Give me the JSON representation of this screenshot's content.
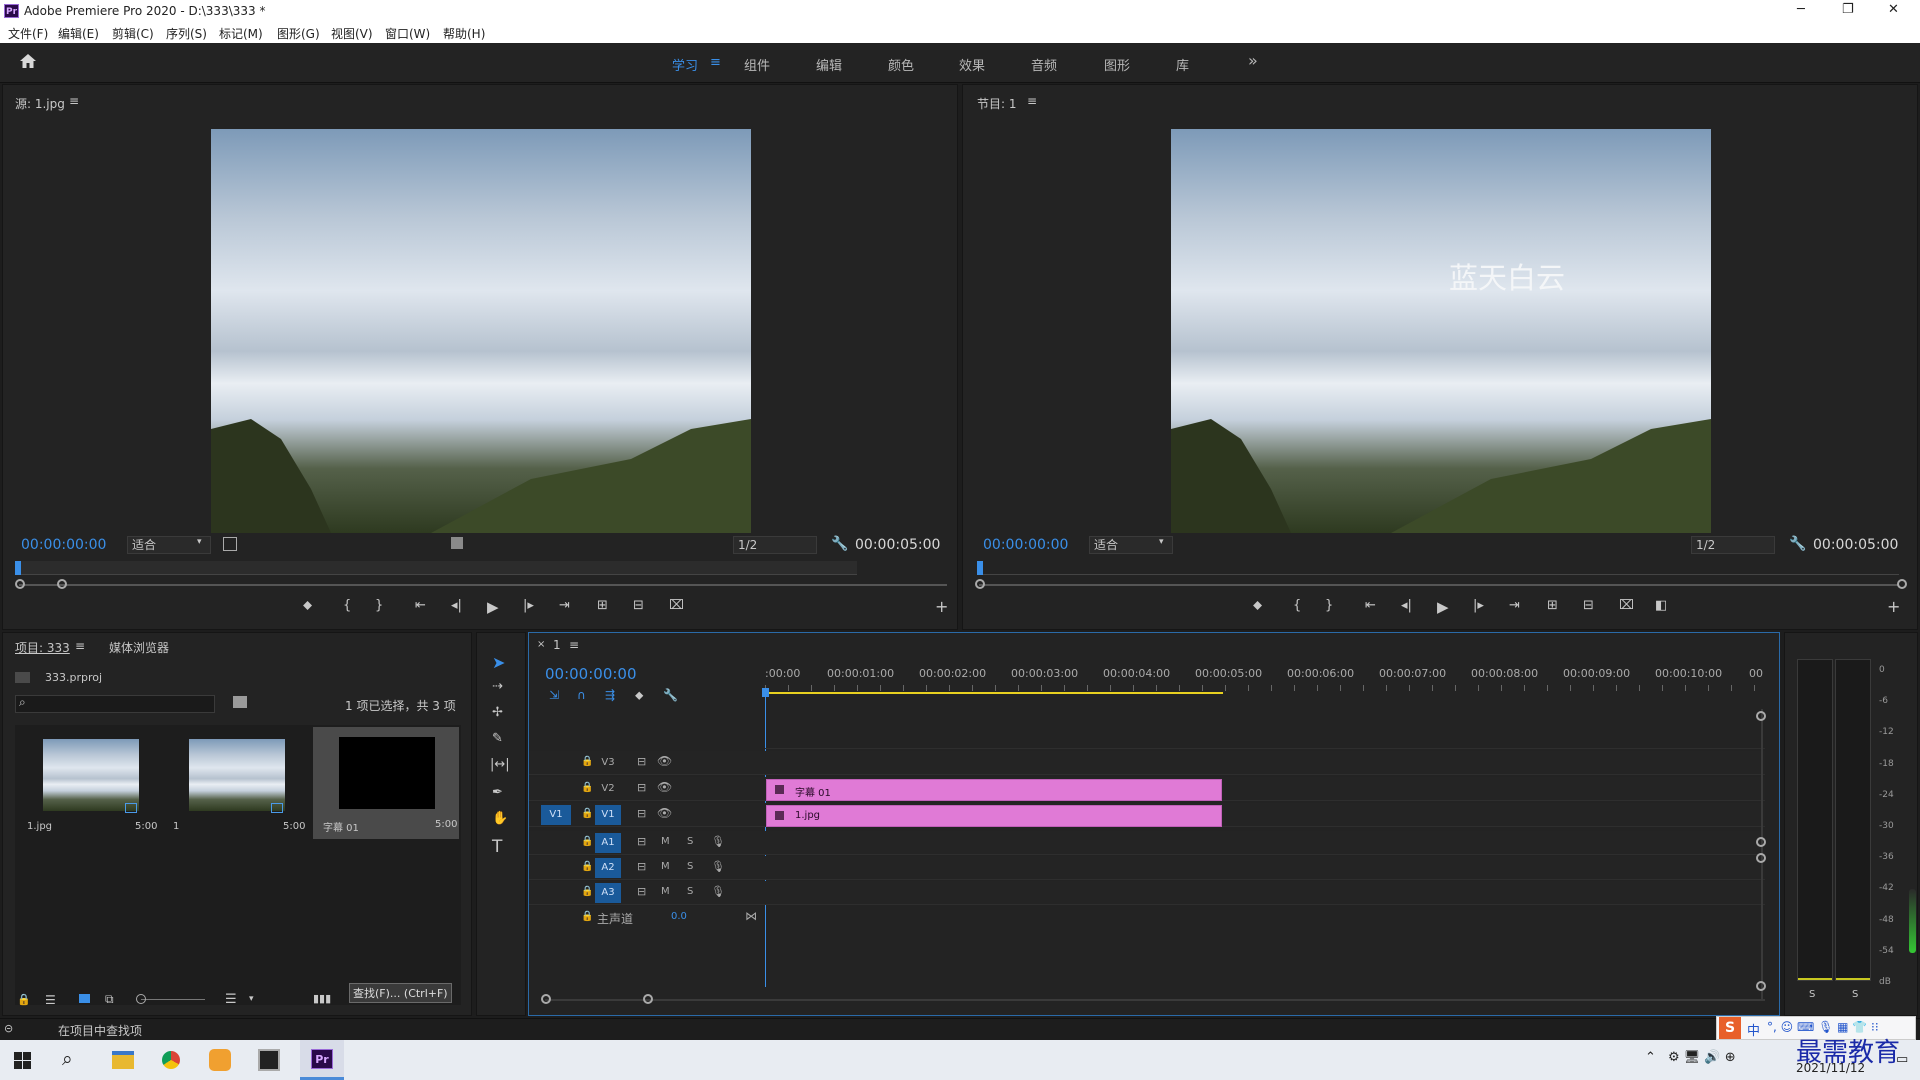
{
  "titlebar": {
    "app_title": "Adobe Premiere Pro 2020 - D:\\333\\333 *",
    "logo": "Pr",
    "minimize": "─",
    "maximize": "❐",
    "close": "✕"
  },
  "menu": [
    "文件(F)",
    "编辑(E)",
    "剪辑(C)",
    "序列(S)",
    "标记(M)",
    "图形(G)",
    "视图(V)",
    "窗口(W)",
    "帮助(H)"
  ],
  "workspace": {
    "tabs": [
      "学习",
      "组件",
      "编辑",
      "颜色",
      "效果",
      "音频",
      "图形",
      "库"
    ],
    "active": "学习",
    "more": "»",
    "menu_glyph": "≡"
  },
  "source": {
    "title": "源: 1.jpg",
    "timecode": "00:00:00:00",
    "fit": "适合",
    "res": "1/2",
    "duration": "00:00:05:00",
    "menu": "≡"
  },
  "program": {
    "title": "节目: 1",
    "timecode": "00:00:00:00",
    "fit": "适合",
    "res": "1/2",
    "duration": "00:00:05:00",
    "caption_overlay": "蓝天白云",
    "menu": "≡"
  },
  "project": {
    "tab": "项目: 333",
    "tab2": "媒体浏览器",
    "file": "333.prproj",
    "selection": "1 项已选择，共 3 项",
    "items": [
      {
        "name": "1.jpg",
        "dur": "5:00"
      },
      {
        "name": "1",
        "dur": "5:00"
      },
      {
        "name": "字幕 01",
        "dur": "5:00"
      }
    ],
    "tooltip": "查找(F)... (Ctrl+F)",
    "menu": "≡"
  },
  "timeline": {
    "tab": "1",
    "close": "×",
    "timecode": "00:00:00:00",
    "ruler": [
      ":00:00",
      "00:00:01:00",
      "00:00:02:00",
      "00:00:03:00",
      "00:00:04:00",
      "00:00:05:00",
      "00:00:06:00",
      "00:00:07:00",
      "00:00:08:00",
      "00:00:09:00",
      "00:00:10:00",
      "00"
    ],
    "video_tracks": [
      "V3",
      "V2",
      "V1"
    ],
    "src_patch": "V1",
    "audio_tracks": [
      "A1",
      "A2",
      "A3"
    ],
    "master": "主声道",
    "master_val": "0.0",
    "m": "M",
    "s": "S",
    "clips": [
      {
        "name": "字幕 01"
      },
      {
        "name": "1.jpg"
      }
    ],
    "menu": "≡"
  },
  "meter": {
    "scale": [
      "0",
      "-6",
      "-12",
      "-18",
      "-24",
      "-30",
      "-36",
      "-42",
      "-48",
      "-54",
      "dB"
    ],
    "s_labels": [
      "S",
      "S"
    ]
  },
  "status": {
    "text": "在项目中查找项"
  },
  "taskbar": {
    "date": "2021/11/12",
    "watermark": "最需教育",
    "ime": "中"
  },
  "colors": {
    "accent": "#3a8fe8",
    "clip": "#e07ad6",
    "bg": "#232323"
  }
}
